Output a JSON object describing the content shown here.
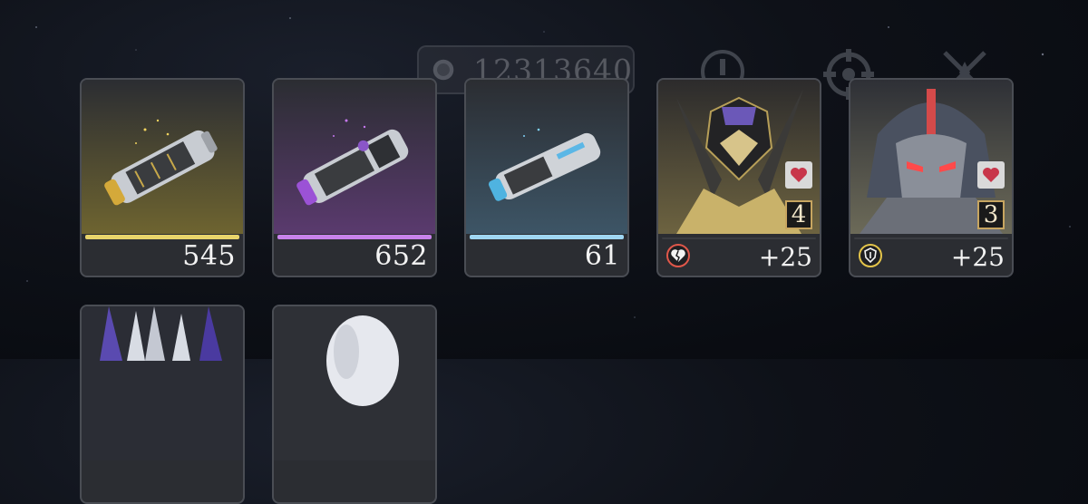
{
  "currency": {
    "amount": "12313640",
    "icon": "coin-icon"
  },
  "header_icons": [
    "alert-icon",
    "target-icon",
    "crossed-swords-icon"
  ],
  "items": [
    {
      "name": "gold-capsule",
      "count": "545",
      "rarity_color": "#e8d46a"
    },
    {
      "name": "purple-capsule",
      "count": "652",
      "rarity_color": "#c782ea"
    },
    {
      "name": "blue-capsule",
      "count": "61",
      "rarity_color": "#9fd6f2"
    }
  ],
  "characters": [
    {
      "name": "gold-armored-character",
      "level": "4",
      "bonus": "+25",
      "emblem": "broken-heart-icon",
      "emblem_color": "#e0574a",
      "badge": "heart-icon"
    },
    {
      "name": "silver-mech-character",
      "level": "3",
      "bonus": "+25",
      "emblem": "shield-icon",
      "emblem_color": "#e3c44a",
      "badge": "heart-icon"
    }
  ]
}
